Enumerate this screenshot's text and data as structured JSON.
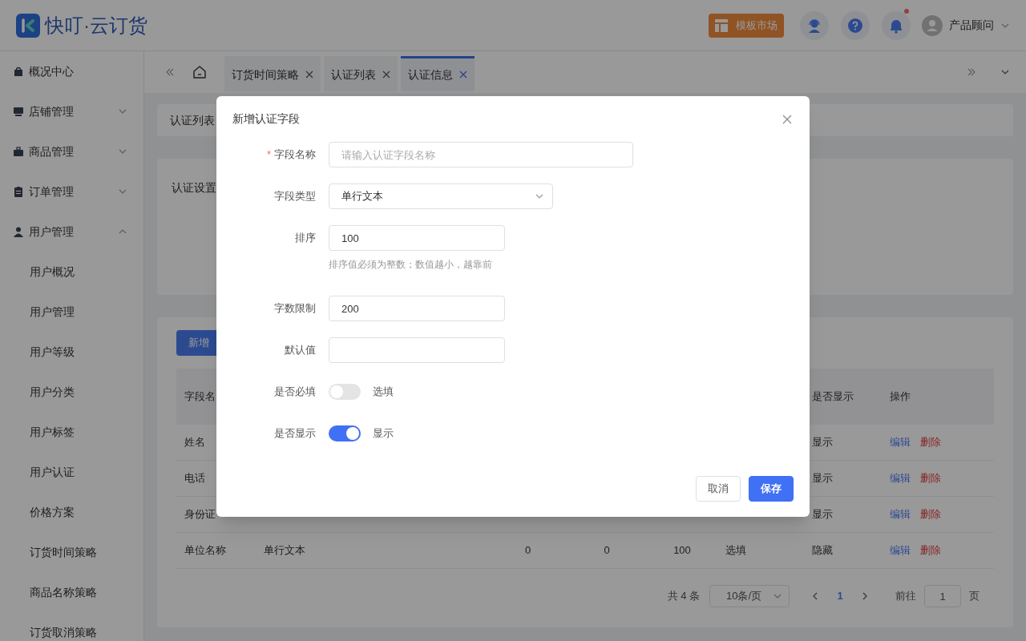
{
  "header": {
    "logo": "快叮·云订货",
    "market_button": "模板市场",
    "notification_dot": true,
    "user": "产品顾问"
  },
  "sidebar": {
    "items": [
      {
        "label": "概况中心"
      },
      {
        "label": "店铺管理",
        "expanded": false
      },
      {
        "label": "商品管理",
        "expanded": false
      },
      {
        "label": "订单管理",
        "expanded": false
      },
      {
        "label": "用户管理",
        "expanded": true,
        "children": [
          {
            "label": "用户概况"
          },
          {
            "label": "用户管理"
          },
          {
            "label": "用户等级"
          },
          {
            "label": "用户分类"
          },
          {
            "label": "用户标签"
          },
          {
            "label": "用户认证"
          },
          {
            "label": "价格方案"
          },
          {
            "label": "订货时间策略"
          },
          {
            "label": "商品名称策略"
          },
          {
            "label": "订货取消策略"
          }
        ]
      }
    ]
  },
  "tabs": [
    {
      "label": "订货时间策略",
      "selected": false
    },
    {
      "label": "认证列表",
      "selected": false
    },
    {
      "label": "认证信息",
      "selected": true
    }
  ],
  "breadcrumb": "认证列表",
  "settings_card": {
    "label": "认证设置"
  },
  "add_button": "新增",
  "table": {
    "columns": [
      {
        "label": "字段名"
      },
      {},
      {},
      {},
      {},
      {},
      {
        "label": "是否显示"
      },
      {
        "label": "操作"
      }
    ],
    "rows": [
      {
        "cells": [
          "姓名",
          "",
          "",
          "",
          "",
          "",
          "显示"
        ],
        "actions": [
          "编辑",
          "删除"
        ]
      },
      {
        "cells": [
          "电话",
          "",
          "",
          "",
          "",
          "",
          "显示"
        ],
        "actions": [
          "编辑",
          "删除"
        ]
      },
      {
        "cells": [
          "身份证",
          "",
          "",
          "",
          "",
          "",
          "显示"
        ],
        "actions": [
          "编辑",
          "删除"
        ]
      },
      {
        "cells": [
          "单位名称",
          "单行文本",
          "0",
          "0",
          "100",
          "选填",
          "隐藏"
        ],
        "actions": [
          "编辑",
          "删除"
        ]
      }
    ]
  },
  "pagination": {
    "total": "共 4 条",
    "page_size": "10条/页",
    "pages": [
      {
        "label": "1",
        "selected": true
      }
    ],
    "goto_label": "前往",
    "goto_value": "1",
    "goto_suffix": "页"
  },
  "dialog": {
    "title": "新增认证字段",
    "fields": [
      {
        "kind": "wide_input",
        "label": "字段名称",
        "required_mark": "*",
        "placeholder": "请输入认证字段名称"
      },
      {
        "kind": "select",
        "label": "字段类型",
        "value": "单行文本"
      },
      {
        "kind": "input",
        "label": "排序",
        "value": "100",
        "hint": "排序值必须为整数；数值越小，越靠前"
      },
      {
        "kind": "input",
        "label": "字数限制",
        "value": "200"
      },
      {
        "kind": "input",
        "label": "默认值"
      },
      {
        "kind": "switch",
        "label": "是否必填",
        "on": false,
        "text": "选填"
      },
      {
        "kind": "switch",
        "label": "是否显示",
        "on": true,
        "text": "显示"
      }
    ],
    "buttons": [
      {
        "label": "取消",
        "kind": "secondary"
      },
      {
        "label": "保存",
        "kind": "primary"
      }
    ]
  }
}
